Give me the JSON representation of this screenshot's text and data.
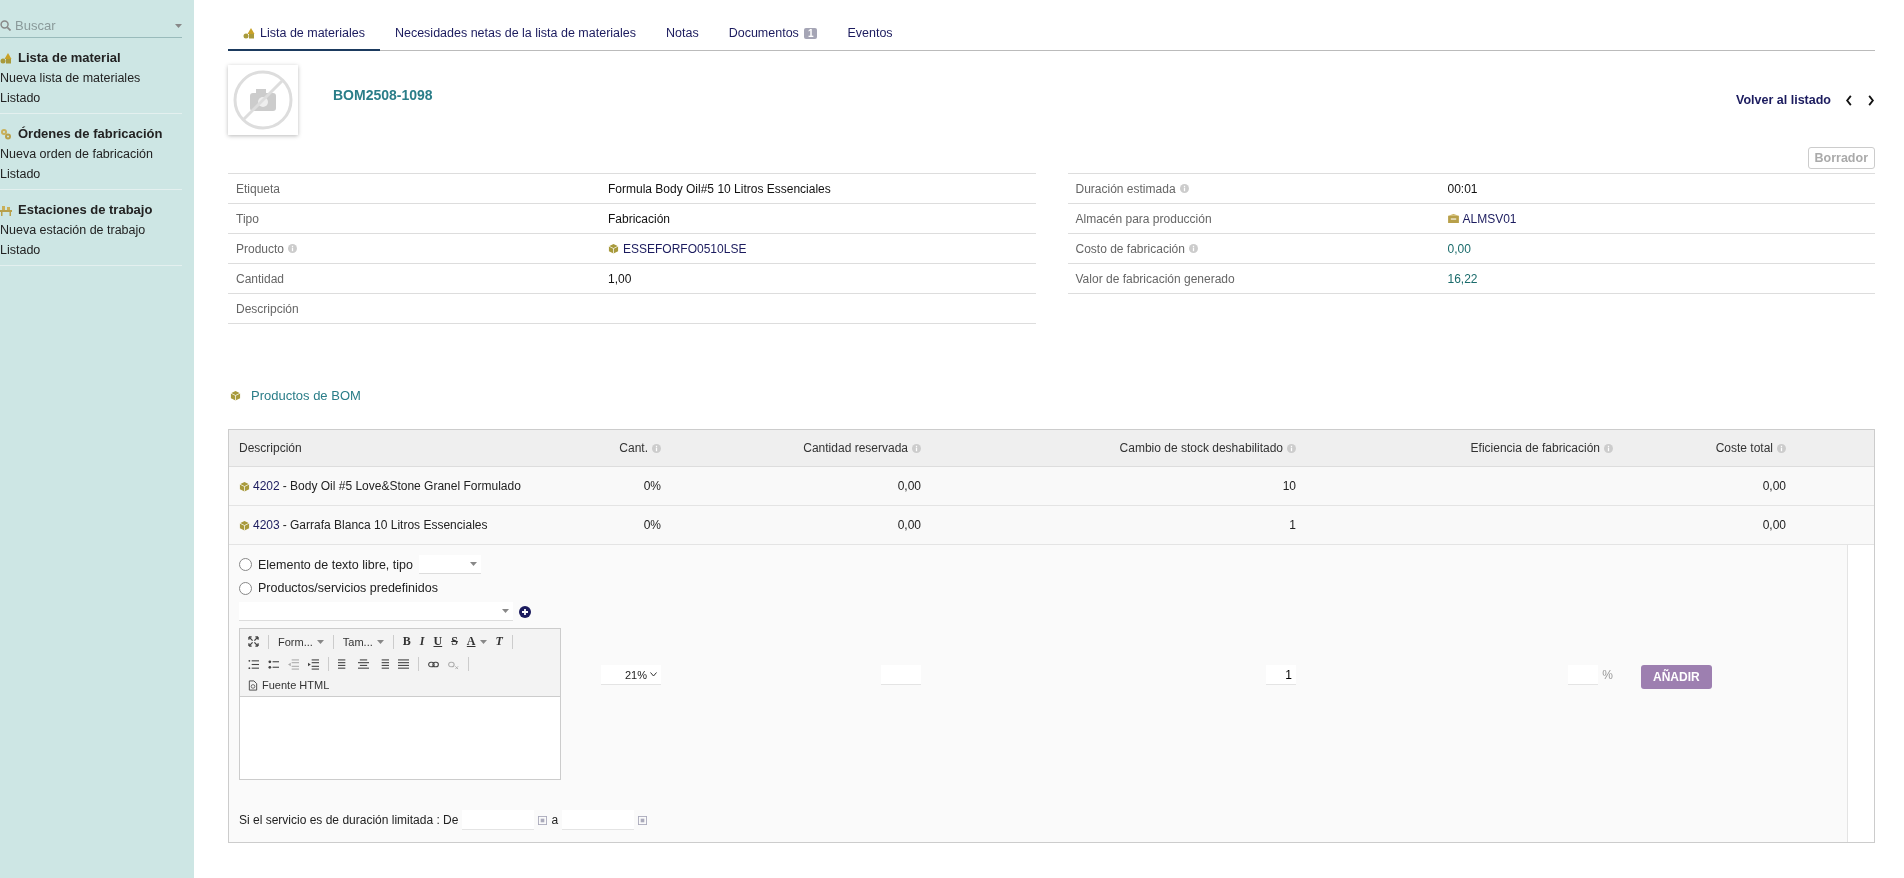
{
  "sidebar": {
    "search": {
      "placeholder": "Buscar"
    },
    "sections": [
      {
        "title": "Lista de material",
        "items": [
          "Nueva lista de materiales",
          "Listado"
        ]
      },
      {
        "title": "Órdenes de fabricación",
        "items": [
          "Nueva orden de fabricación",
          "Listado"
        ]
      },
      {
        "title": "Estaciones de trabajo",
        "items": [
          "Nueva estación de trabajo",
          "Listado"
        ]
      }
    ]
  },
  "tabs": [
    {
      "label": "Lista de materiales",
      "selected": true
    },
    {
      "label": "Necesidades netas de la lista de materiales",
      "selected": false
    },
    {
      "label": "Notas",
      "selected": false
    },
    {
      "label": "Documentos",
      "selected": false,
      "badge": "1"
    },
    {
      "label": "Eventos",
      "selected": false
    }
  ],
  "record": {
    "ref": "BOM2508-1098",
    "back_link": "Volver al listado",
    "status": "Borrador"
  },
  "fields_left": [
    {
      "label": "Etiqueta",
      "info": false,
      "kind": "text",
      "value": "Formula Body Oil#5 10 Litros Essenciales"
    },
    {
      "label": "Tipo",
      "info": false,
      "kind": "text",
      "value": "Fabricación"
    },
    {
      "label": "Producto",
      "info": true,
      "kind": "product_link",
      "value": "ESSEFORFO0510LSE"
    },
    {
      "label": "Cantidad",
      "info": false,
      "kind": "text",
      "value": "1,00"
    },
    {
      "label": "Descripción",
      "info": false
    }
  ],
  "fields_right": [
    {
      "label": "Duración estimada",
      "info": true,
      "kind": "text",
      "value": "00:01"
    },
    {
      "label": "Almacén para producción",
      "info": false,
      "kind": "warehouse_link",
      "value": "ALMSV01"
    },
    {
      "label": "Costo de fabricación",
      "info": true,
      "kind": "amount",
      "value": "0,00"
    },
    {
      "label": "Valor de fabricación generado",
      "info": false,
      "kind": "amount",
      "value": "16,22"
    }
  ],
  "bom": {
    "title": "Productos de BOM",
    "columns": [
      {
        "label": "Descripción",
        "info": false
      },
      {
        "label": "Cant.",
        "info": true
      },
      {
        "label": "Cantidad reservada",
        "info": true
      },
      {
        "label": "Cambio de stock deshabilitado",
        "info": true
      },
      {
        "label": "Eficiencia de fabricación",
        "info": true
      },
      {
        "label": "Coste total",
        "info": true
      }
    ],
    "rows": [
      {
        "ref": "4202",
        "label": " - Body Oil #5 Love&Stone Granel Formulado",
        "qty": "0%",
        "reserved": "0,00",
        "stock_change": "10",
        "total_cost": "0,00"
      },
      {
        "ref": "4203",
        "label": " - Garrafa Blanca 10 Litros Essenciales",
        "qty": "0%",
        "reserved": "0,00",
        "stock_change": "1",
        "total_cost": "0,00"
      }
    ]
  },
  "add_form": {
    "radios": [
      {
        "label": "Elemento de texto libre, tipo",
        "selected": false
      },
      {
        "label": "Productos/servicios predefinidos",
        "selected": false
      }
    ],
    "editor": {
      "format": "Form...",
      "size": "Tam...",
      "letters": [
        {
          "kind": "bold",
          "text": "B"
        },
        {
          "kind": "italic",
          "text": "I"
        },
        {
          "kind": "underline",
          "text": "U"
        },
        {
          "kind": "strike",
          "text": "S"
        },
        {
          "kind": "color",
          "text": "A"
        },
        {
          "kind": "clear",
          "text": "T"
        }
      ],
      "source": "Fuente HTML"
    },
    "vat": "21%",
    "qty": "1",
    "percent_suffix": "%",
    "add_button": "AÑADIR",
    "duration": {
      "label": "Si el servicio es de duración limitada : De",
      "connector": "a"
    }
  }
}
